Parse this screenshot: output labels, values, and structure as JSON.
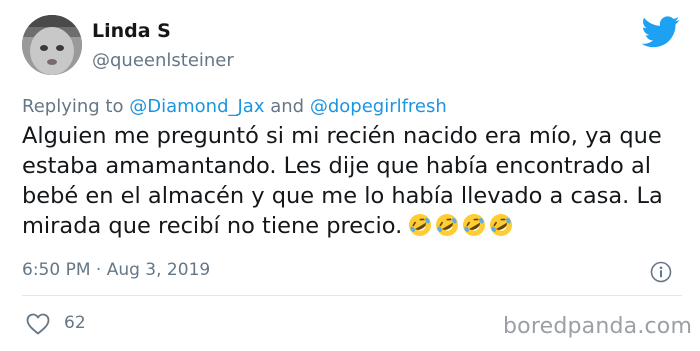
{
  "user": {
    "display_name": "Linda S",
    "handle": "@queenlsteiner",
    "avatar_icon": "baby-avatar"
  },
  "brand": {
    "icon": "twitter-bird-icon",
    "color": "#1da1f2"
  },
  "reply": {
    "prefix": "Replying to",
    "mention_1": "@Diamond_Jax",
    "joiner": "and",
    "mention_2": "@dopegirlfresh",
    "mention_color": "#1b95e0"
  },
  "tweet": {
    "lines": [
      "Alguien me preguntó si mi recién nacido era mío, ya que",
      "estaba amamantando. Les dije que había encontrado al",
      "bebé en el almacén y que me lo había llevado a casa. La",
      "mirada que recibí no tiene precio."
    ],
    "emojis": [
      "rolling-on-floor-laughing-emoji",
      "rolling-on-floor-laughing-emoji",
      "rolling-on-floor-laughing-emoji",
      "rolling-on-floor-laughing-emoji"
    ]
  },
  "meta": {
    "timestamp": "6:50 PM · Aug 3, 2019",
    "info_icon": "info-icon"
  },
  "engagement": {
    "like_icon": "heart-icon",
    "like_count": "62"
  },
  "watermark": "boredpanda.com"
}
